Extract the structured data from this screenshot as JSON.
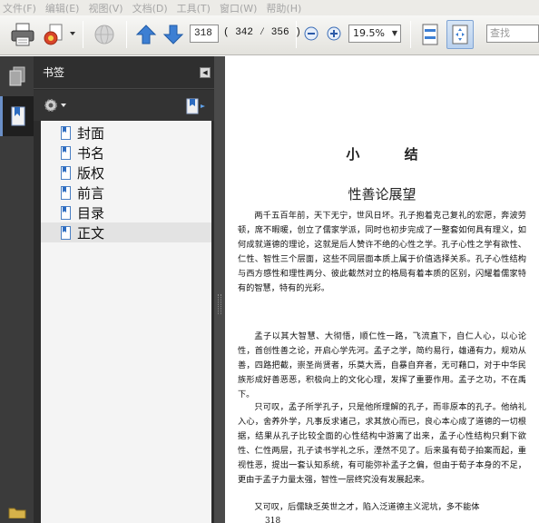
{
  "menu": [
    "文件(F)",
    "编辑(E)",
    "视图(V)",
    "文档(D)",
    "工具(T)",
    "窗口(W)",
    "帮助(H)"
  ],
  "toolbar": {
    "icons": [
      "print-icon",
      "email-icon",
      "chevron-down-icon",
      "globe-icon",
      "arrow-up-icon",
      "arrow-down-icon",
      "zoom-out-icon",
      "zoom-in-icon",
      "chevron-down-icon",
      "fit-page-icon",
      "fit-width-icon"
    ],
    "current_page": "318",
    "page_count": "( 342 ⁄ 356 )",
    "zoom": "19.5%",
    "search_placeholder": "查找"
  },
  "sidebar": {
    "title": "书签",
    "options_icon": "gear-icon",
    "bookmarks": [
      {
        "label": "封面"
      },
      {
        "label": "书名"
      },
      {
        "label": "版权"
      },
      {
        "label": "前言"
      },
      {
        "label": "目录"
      },
      {
        "label": "正文"
      }
    ],
    "selected": "正文"
  },
  "document": {
    "title": "小  结",
    "subtitle": "性善论展望",
    "paragraphs": [
      "两千五百年前，天下无宁，世风日坏。孔子抱着克己复礼的宏愿，奔波劳顿，席不暇暖，创立了儒家学派，同时也初步完成了一整套如何具有理义，如何成就道德的理论，这就是后人赞许不绝的心性之学。孔子心性之学有欲性、仁性、智性三个层面，这些不同层面本质上属于价值选择关系。孔子心性结构与西方感性和理性两分、彼此截然对立的格局有着本质的区别，闪耀着儒家特有的智慧，特有的光彩。",
      "孟子以其大智慧、大彻悟，顺仁性一路，飞流直下，自仁人心，以心论性，首创性善之论，开启心学先河。孟子之学，简约易行，雄通有力，规劝从善，四路把截，崇圣尚贤者，乐莫大焉，自暴自弃者，无可藉口，对于中华民族形成好善恶恶，积极向上的文化心理，发挥了重要作用。孟子之功，不在禹下。",
      "只可叹，孟子所学孔子，只是他所理解的孔子，而非原本的孔子。他纳礼入心，舍养外学，凡事反求诸己，求其放心而已，良心本心成了道德的一切根据，结果从孔子比较全面的心性结构中游离了出来，孟子心性结构只剩下欲性、仁性两层，孔子读书学礼之乐，湮然不见了。后来虽有荀子拍案而起，重视性恶，提出一套认知系统，有可能弥补孟子之偏，但由于荀子本身的不足，更由于孟子力量太强，智性一层终究没有发展起来。",
      "又可叹，后儒缺乏英世之才，陷入泛道德主义泥坑，多不能体"
    ],
    "page_number": "318"
  }
}
